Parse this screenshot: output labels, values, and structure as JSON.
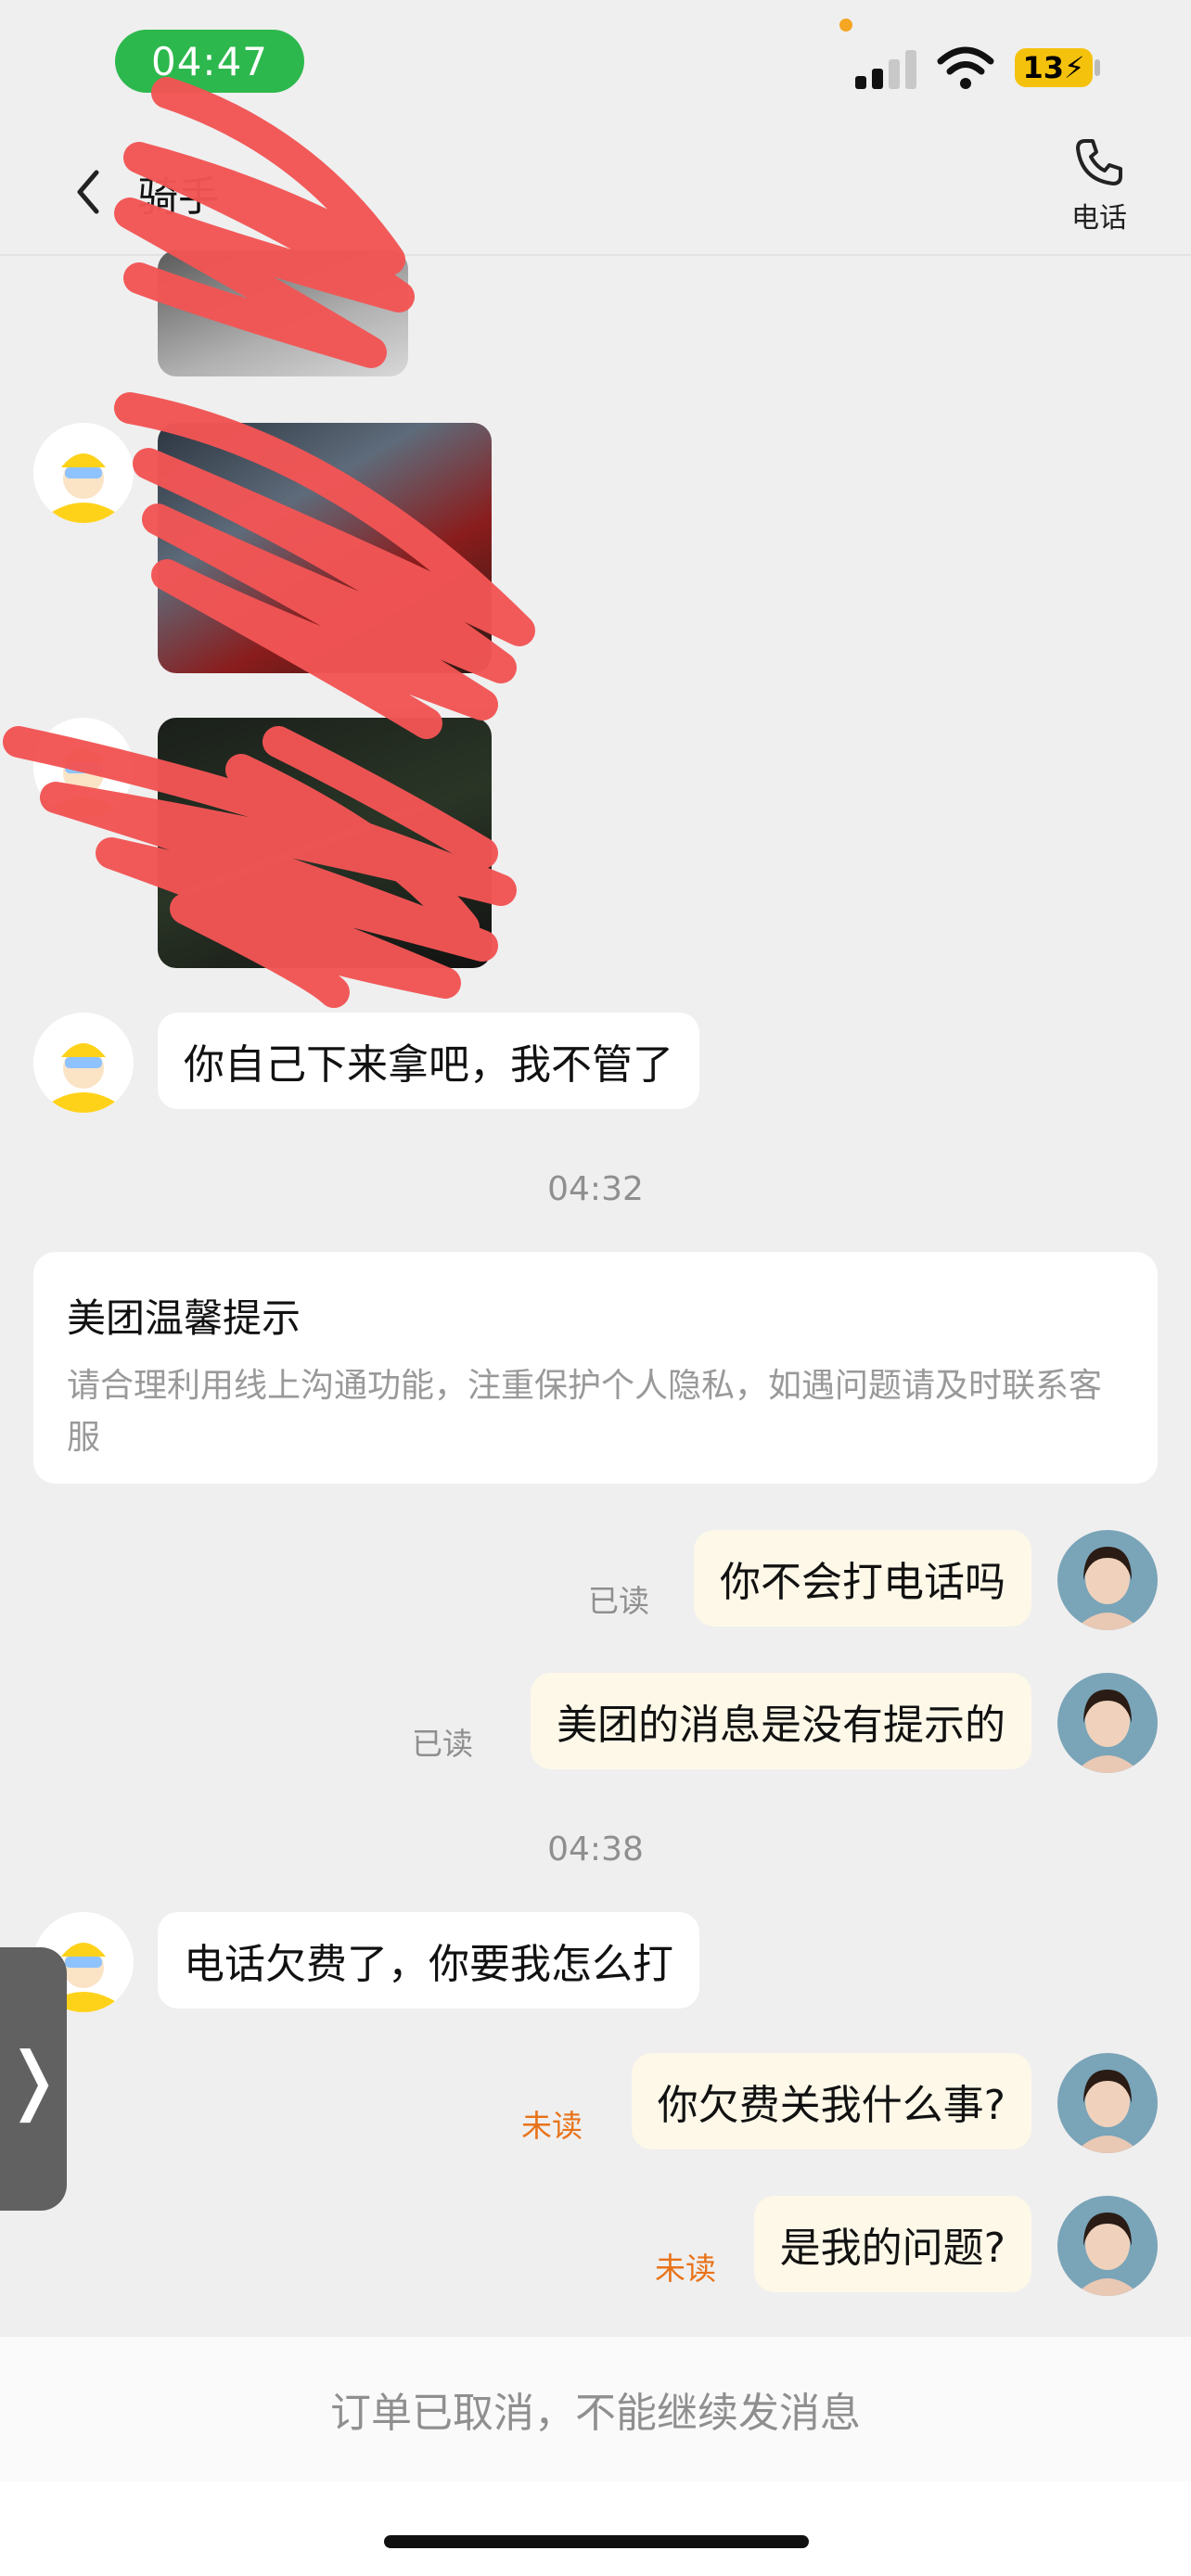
{
  "status_bar": {
    "time": "04:47",
    "battery": "13",
    "icons": [
      "signal-icon",
      "wifi-icon",
      "battery-charging-icon"
    ]
  },
  "header": {
    "title": "骑手",
    "phone_label": "电话",
    "icons": [
      "back-chevron-icon",
      "phone-icon"
    ]
  },
  "messages": {
    "rider_text_1": "你自己下来拿吧，我不管了",
    "time_1": "04:32",
    "tip": {
      "title": "美团温馨提示",
      "body": "请合理利用线上沟通功能，注重保护个人隐私，如遇问题请及时联系客服"
    },
    "user_text_1": "你不会打电话吗",
    "user_status_1": "已读",
    "user_text_2": "美团的消息是没有提示的",
    "user_status_2": "已读",
    "time_2": "04:38",
    "rider_text_2": "电话欠费了，你要我怎么打",
    "user_text_3": "你欠费关我什么事?",
    "user_status_3": "未读",
    "user_text_4": "是我的问题?",
    "user_status_4": "未读"
  },
  "footer": {
    "notice": "订单已取消，不能继续发消息"
  },
  "colors": {
    "status_green": "#2db84d",
    "battery_yellow": "#f4c20d",
    "unread_orange": "#e8731a",
    "user_bubble": "#fdf8e8",
    "scribble_red": "#f25555"
  }
}
